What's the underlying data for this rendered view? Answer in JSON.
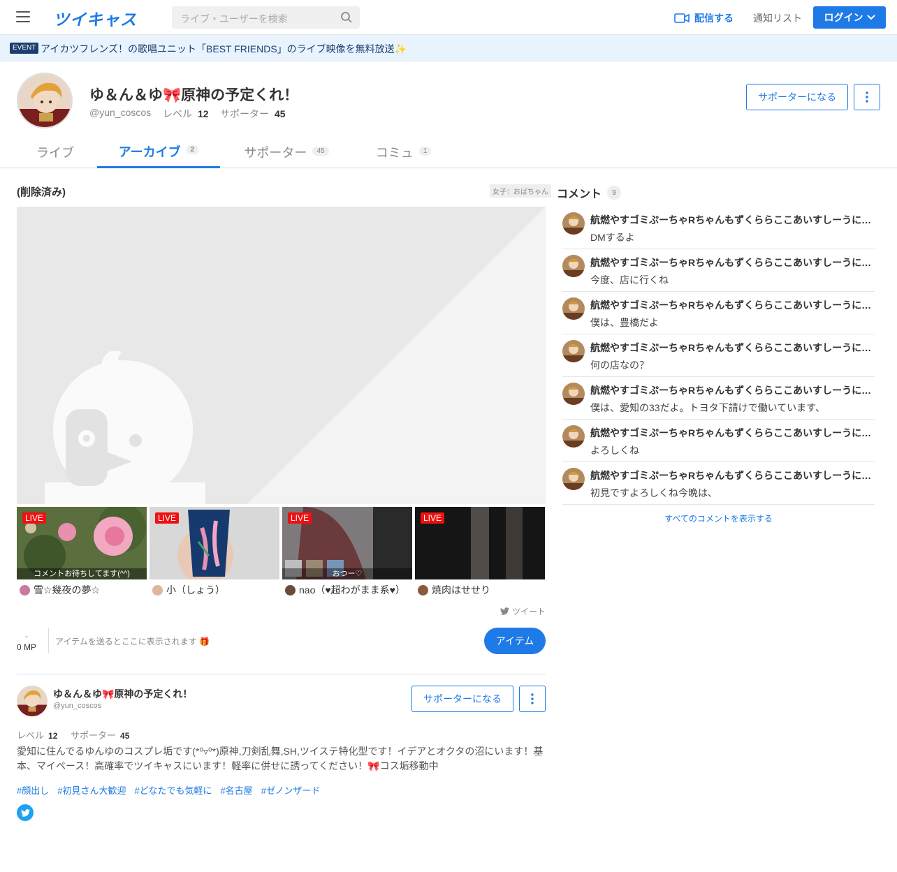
{
  "header": {
    "logo": "ツイキャス",
    "search_placeholder": "ライブ・ユーザーを検索",
    "broadcast_label": "配信する",
    "notify_label": "通知リスト",
    "login_label": "ログイン",
    "accent": "#1e7ae6"
  },
  "event": {
    "badge": "EVENT",
    "text": "アイカツフレンズ！の歌唱ユニット「BEST FRIENDS」のライブ映像を無料放送✨"
  },
  "profile": {
    "name": "ゆ＆ん＆ゆ🎀原神の予定くれ！",
    "user_id": "@yun_coscos",
    "level_label": "レベル",
    "level": "12",
    "supporter_label": "サポーター",
    "supporters": "45",
    "support_button": "サポーターになる"
  },
  "tabs": [
    {
      "label": "ライブ",
      "count": ""
    },
    {
      "label": "アーカイブ",
      "count": "2"
    },
    {
      "label": "サポーター",
      "count": "45"
    },
    {
      "label": "コミュ",
      "count": "1"
    }
  ],
  "video": {
    "title": "(削除済み)",
    "category": "女子：おばちゃん"
  },
  "live_thumbs": [
    {
      "badge": "LIVE",
      "caption": "コメントお待ちしてます(^^)",
      "name": "雪☆幾夜の夢☆"
    },
    {
      "badge": "LIVE",
      "caption": "",
      "name": "小（しょう）"
    },
    {
      "badge": "LIVE",
      "caption": "おつー♡",
      "name": "nao（♥超わがまま系♥）"
    },
    {
      "badge": "LIVE",
      "caption": "",
      "name": "焼肉はせせり"
    }
  ],
  "actions": {
    "tweet": "ツイート",
    "mp_dash": "-",
    "mp": "0 MP",
    "item_hint": "アイテムを送るとここに表示されます 🎁",
    "item_button": "アイテム"
  },
  "bio": {
    "name": "ゆ＆ん＆ゆ🎀原神の予定くれ！",
    "user_id": "@yun_coscos",
    "support_button": "サポーターになる",
    "level_label": "レベル",
    "level": "12",
    "supporter_label": "サポーター",
    "supporters": "45",
    "text": "愛知に住んでるゆんゆのコスプレ垢です(*⁰▿⁰*)原神,刀剣乱舞,SH,ツイステ特化型です！イデアとオクタの沼にいます！基本、マイペース！高確率でツイキャスにいます！軽率に併せに誘ってください！🎀コス垢移動中",
    "tags": [
      "#顔出し",
      "#初見さん大歓迎",
      "#どなたでも気軽に",
      "#名古屋",
      "#ゼノンザード"
    ]
  },
  "comments": {
    "title": "コメント",
    "count": "9",
    "items": [
      {
        "name": "航燃やすゴミぷーちゃRちゃんもずくららここあいすしーうに…",
        "text": "DMするよ"
      },
      {
        "name": "航燃やすゴミぷーちゃRちゃんもずくららここあいすしーうに…",
        "text": "今度、店に行くね"
      },
      {
        "name": "航燃やすゴミぷーちゃRちゃんもずくららここあいすしーうに…",
        "text": "僕は、豊橋だよ"
      },
      {
        "name": "航燃やすゴミぷーちゃRちゃんもずくららここあいすしーうに…",
        "text": "何の店なの？"
      },
      {
        "name": "航燃やすゴミぷーちゃRちゃんもずくららここあいすしーうに…",
        "text": "僕は、愛知の33だよ。トヨタ下請けで働いています、"
      },
      {
        "name": "航燃やすゴミぷーちゃRちゃんもずくららここあいすしーうに…",
        "text": "よろしくね"
      },
      {
        "name": "航燃やすゴミぷーちゃRちゃんもずくららここあいすしーうに…",
        "text": "初見ですよろしくね今晩は、"
      }
    ],
    "show_all": "すべてのコメントを表示する"
  }
}
